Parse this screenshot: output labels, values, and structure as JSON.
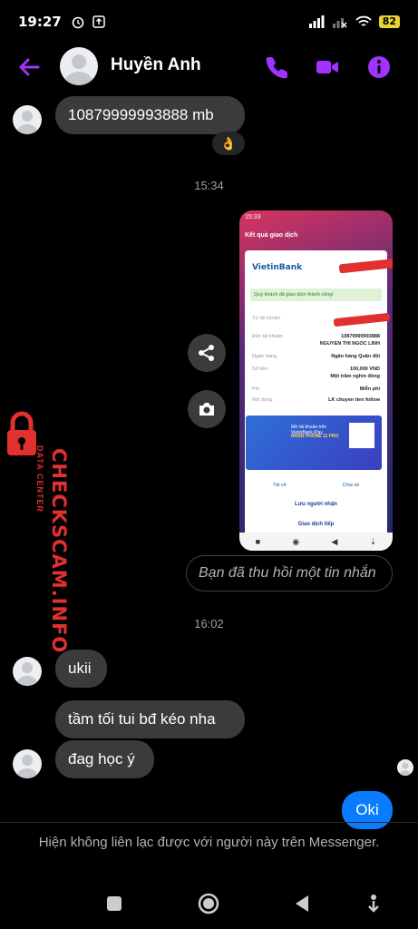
{
  "status_bar": {
    "time": "19:27",
    "battery": "82"
  },
  "header": {
    "contact_name": "Huyền Anh"
  },
  "messages": {
    "msg1": "10879999993888 mb",
    "reaction1": "👌",
    "timestamp1": "15:34",
    "unsent_notice": "Bạn đã thu hồi một tin nhắn",
    "timestamp2": "16:02",
    "msg2": "ukii",
    "msg3": "tầm tối tui bđ kéo nha",
    "msg4": "đag học ý",
    "msg_out": "Oki"
  },
  "attachment_screenshot": {
    "time": "15:33",
    "title": "Kết quả giao dịch",
    "bank_logo": "VietinBank",
    "success_text": "Quý khách đã giao dịch thành công!",
    "rows": [
      {
        "label": "Từ tài khoản",
        "value": ""
      },
      {
        "label": "Đến tài khoản",
        "value": "10879999993888"
      },
      {
        "label": "",
        "value": "NGUYEN THI NGOC LINH"
      },
      {
        "label": "Ngân hàng",
        "value": "Ngân hàng Quân đội"
      },
      {
        "label": "Số tiền",
        "value": "100,000 VND"
      },
      {
        "label": "",
        "value": "Một trăm nghìn đồng"
      },
      {
        "label": "Phí",
        "value": "Miễn phí"
      },
      {
        "label": "Nội dung",
        "value": "LK chuyen tien follow"
      }
    ],
    "banner_line1": "Mở tài khoản trên VietinBank iPay",
    "banner_line2": "NHẬN PHONE 11 PRO",
    "action_save": "Tải về",
    "action_share": "Chia sẻ",
    "btn_save_recipient": "Lưu người nhận",
    "btn_continue": "Giao dịch tiếp"
  },
  "watermark": {
    "main": "CHECKSCAM.INFO",
    "sub": "DATA CENTER"
  },
  "footer_notice": "Hiện không liên lạc được với người này trên Messenger.",
  "colors": {
    "accent": "#a033ff",
    "outgoing": "#0a7cff",
    "incoming": "#3a3b3c",
    "watermark": "#e0302f"
  }
}
